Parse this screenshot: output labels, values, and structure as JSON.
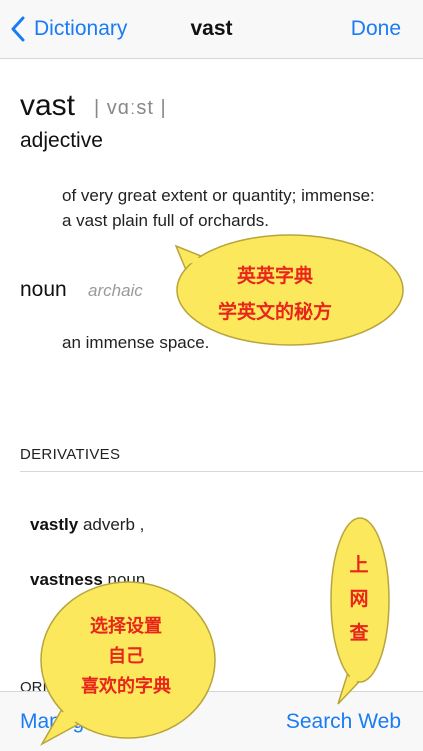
{
  "nav": {
    "back_label": "Dictionary",
    "title": "vast",
    "done_label": "Done"
  },
  "entry": {
    "headword": "vast",
    "pronunciation": "| vɑːst |",
    "senses": [
      {
        "pos": "adjective",
        "tag": "",
        "definition": "of very great extent or quantity; immense:",
        "example": "a vast plain full of orchards."
      },
      {
        "pos": "noun",
        "tag": "archaic",
        "definition": "an immense space.",
        "example": ""
      }
    ]
  },
  "derivatives": {
    "header": "DERIVATIVES",
    "items": [
      {
        "word": "vastly",
        "pos": "adverb ,"
      },
      {
        "word": "vastness",
        "pos": "noun"
      }
    ]
  },
  "origin": {
    "header_partial": "ORI"
  },
  "toolbar": {
    "left_label": "Manage",
    "right_label": "Search Web"
  },
  "promo_bubbles": [
    {
      "line1": "英英字典",
      "line2": "学英文的秘方"
    },
    {
      "line1": "选择设置",
      "line2": "自己",
      "line3": "喜欢的字典"
    },
    {
      "line1": "上",
      "line2": "网",
      "line3": "查"
    }
  ],
  "colors": {
    "accent": "#1a7cf5",
    "bubble_fill": "#fbe85c",
    "bubble_text": "#e8261b",
    "bubble_stroke": "#b8a53a"
  }
}
